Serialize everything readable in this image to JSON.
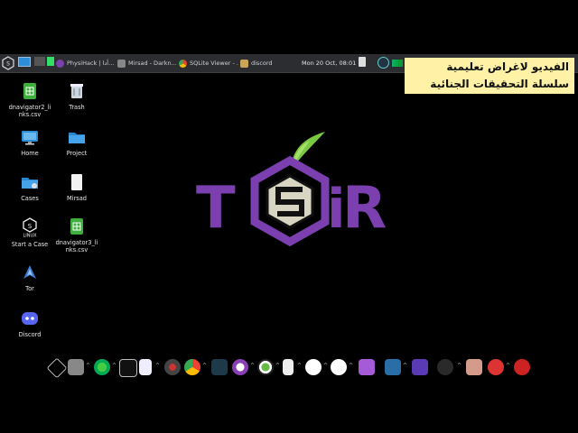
{
  "topbar": {
    "tasks": [
      "PhysiHack | أدا...",
      "Mirsad - Darkn...",
      "SQLite Viewer - ...",
      "discord"
    ],
    "clock": "Mon 20 Oct, 08:01"
  },
  "caption": {
    "line1": "الفيديو لاغراض تعليمية",
    "line2": "سلسلة التحقيقات الجنائية"
  },
  "desktop": {
    "items": [
      {
        "label": "dnavigator2_links.csv",
        "icon": "spreadsheet-icon"
      },
      {
        "label": "Trash",
        "icon": "trash-icon"
      },
      {
        "label": "Home",
        "icon": "monitor-icon"
      },
      {
        "label": "Project",
        "icon": "folder-icon"
      },
      {
        "label": "Cases",
        "icon": "folder-icon"
      },
      {
        "label": "Mirsad",
        "icon": "document-icon"
      },
      {
        "label": "Start a Case",
        "icon": "linux-s-icon"
      },
      {
        "label": "dnavigator3_links.csv",
        "icon": "spreadsheet-icon"
      },
      {
        "label": "Tor",
        "icon": "tor-icon"
      },
      {
        "label": "Discord",
        "icon": "discord-icon"
      }
    ]
  },
  "wallpaper": {
    "logo_letters": [
      "T",
      "S",
      "i",
      "R"
    ],
    "accent": "#7b3fb0",
    "hex_fill": "#d8d5c3",
    "leaf": "#7ac943"
  },
  "colors": {
    "panel": "#2b2d30",
    "caption_bg": "#fff2a6"
  }
}
